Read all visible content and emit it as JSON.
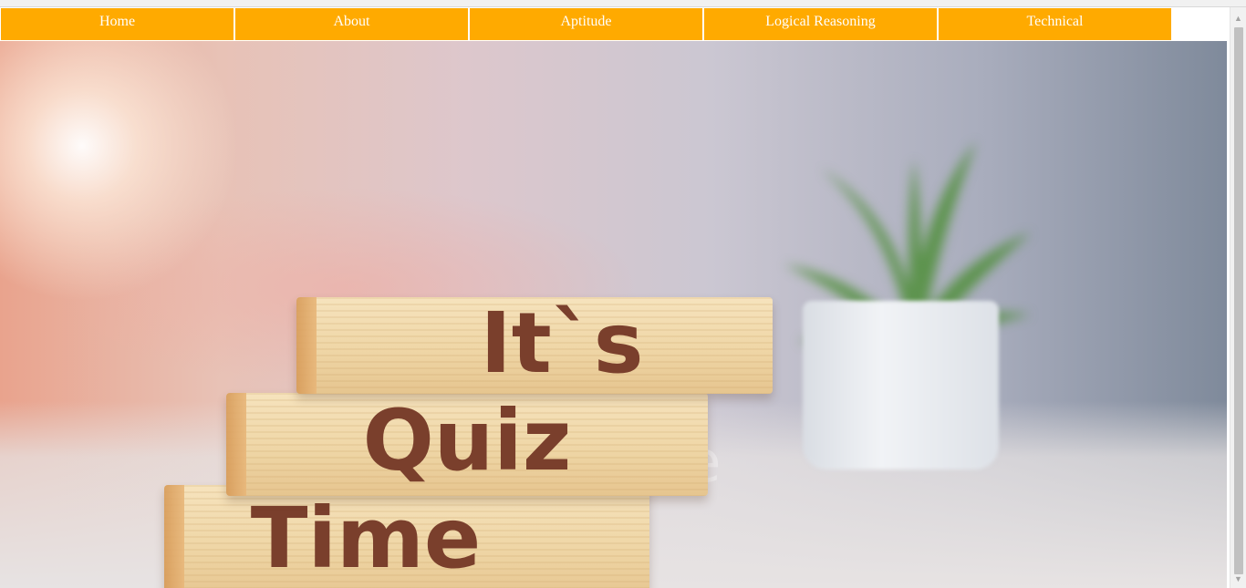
{
  "nav": {
    "items": [
      {
        "label": "Home"
      },
      {
        "label": "About"
      },
      {
        "label": "Aptitude"
      },
      {
        "label": "Logical Reasoning"
      },
      {
        "label": "Technical"
      }
    ]
  },
  "hero": {
    "line1": "It`s",
    "line2": "Quiz",
    "line3": "Time",
    "watermark": "dreamstime"
  },
  "scrollbar": {
    "up_glyph": "▲",
    "down_glyph": "▼"
  },
  "colors": {
    "nav_bg": "#ffaa00",
    "nav_text": "#ffffff",
    "block_text": "#7a3f2c"
  }
}
